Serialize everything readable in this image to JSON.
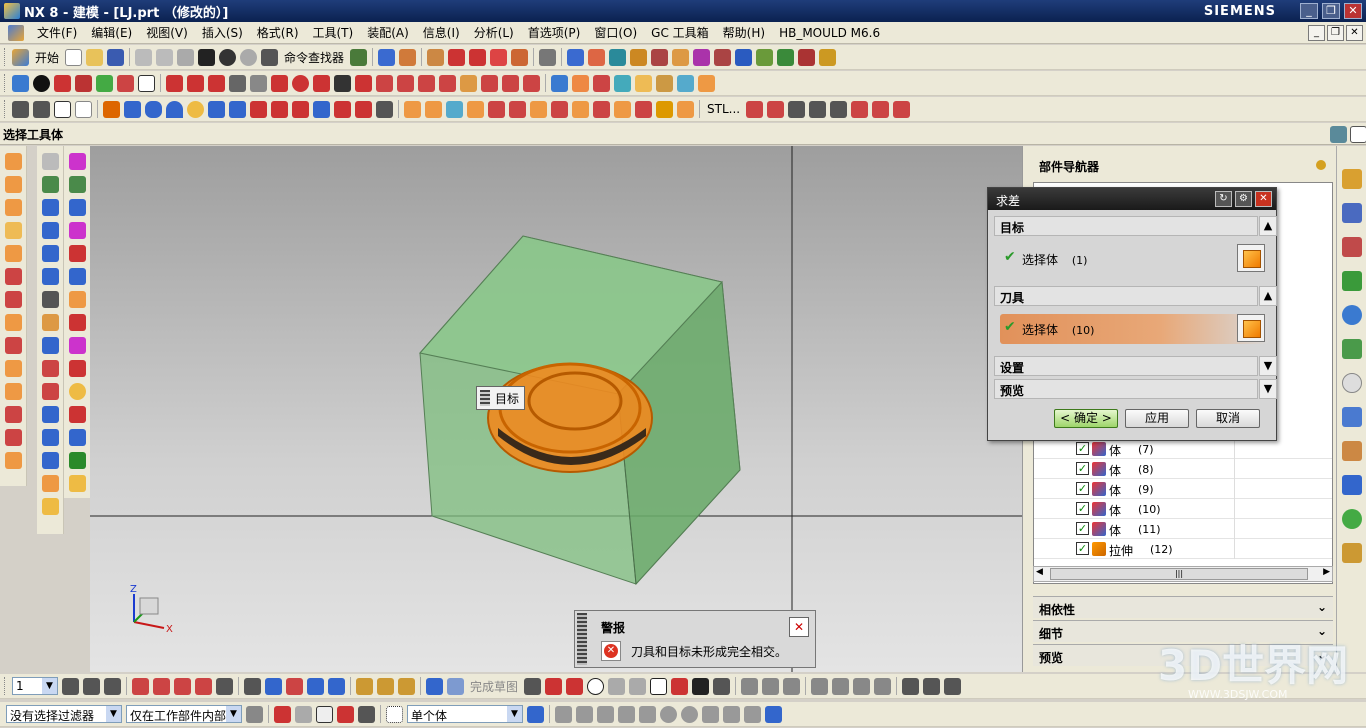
{
  "window": {
    "title": "NX 8 - 建模 - [LJ.prt （修改的）]",
    "brand": "SIEMENS"
  },
  "menubar": {
    "items": [
      "文件(F)",
      "编辑(E)",
      "视图(V)",
      "插入(S)",
      "格式(R)",
      "工具(T)",
      "装配(A)",
      "信息(I)",
      "分析(L)",
      "首选项(P)",
      "窗口(O)",
      "GC 工具箱",
      "帮助(H)",
      "HB_MOULD M6.6"
    ]
  },
  "toolbar1": {
    "start_label": "开始",
    "command_finder_label": "命令查找器"
  },
  "toolbar3": {
    "stl_label": "STL..."
  },
  "selection_bar": {
    "label": "选择工具体"
  },
  "viewport": {
    "target_label": "目标"
  },
  "part_navigator": {
    "title": "部件导航器",
    "rows": [
      {
        "name": "体",
        "index": "(7)"
      },
      {
        "name": "体",
        "index": "(8)"
      },
      {
        "name": "体",
        "index": "(9)"
      },
      {
        "name": "体",
        "index": "(10)"
      },
      {
        "name": "体",
        "index": "(11)"
      },
      {
        "name": "拉伸",
        "index": "(12)"
      }
    ],
    "sections": [
      "相依性",
      "细节",
      "预览"
    ]
  },
  "dialog": {
    "title": "求差",
    "target_group": "目标",
    "target_select": "选择体",
    "target_count": "(1)",
    "tool_group": "刀具",
    "tool_select": "选择体",
    "tool_count": "(10)",
    "settings_group": "设置",
    "preview_group": "预览",
    "ok_label": "< 确定 >",
    "apply_label": "应用",
    "cancel_label": "取消"
  },
  "alert": {
    "title": "警报",
    "message": "刀具和目标未形成完全相交。"
  },
  "bottom_toolbar": {
    "finish_sketch_label": "完成草图",
    "layer_value": "1",
    "filter_value": "没有选择过滤器",
    "scope_value": "仅在工作部件内部",
    "body_value": "单个体"
  },
  "watermark": {
    "text": "3D世界网",
    "url": "WWW.3DSJW.COM"
  },
  "colors": {
    "accent": "#ef8a1f",
    "block": "#7fc07f",
    "title_bg": "#1f3d7a"
  }
}
